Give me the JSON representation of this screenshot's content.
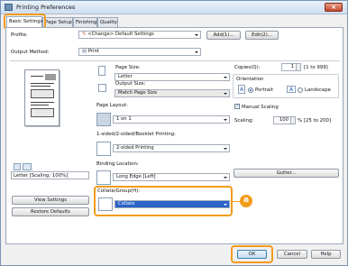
{
  "window": {
    "title": "Printing Preferences",
    "close_label": "×"
  },
  "tabs": [
    {
      "label": "Basic Settings"
    },
    {
      "label": "Page Setup"
    },
    {
      "label": "Finishing"
    },
    {
      "label": "Quality"
    }
  ],
  "profile": {
    "label": "Profile:",
    "value": "<Change> Default Settings",
    "add_label": "Add(1)...",
    "edit_label": "Edit(2)..."
  },
  "output_method": {
    "label": "Output Method:",
    "value": "Print"
  },
  "left": {
    "scaling_text": "Letter [Scaling: 100%]",
    "view_settings_label": "View Settings",
    "restore_defaults_label": "Restore Defaults"
  },
  "page_size": {
    "label": "Page Size:",
    "value": "Letter"
  },
  "output_size": {
    "label": "Output Size:",
    "value": "Match Page Size"
  },
  "page_layout": {
    "label": "Page Layout:",
    "value": "1 on 1"
  },
  "booklet": {
    "label": "1-sided/2-sided/Booklet Printing:",
    "value": "2-sided Printing"
  },
  "binding": {
    "label": "Binding Location:",
    "value": "Long Edge [Left]",
    "gutter_label": "Gutter..."
  },
  "collate": {
    "label": "Collate/Group(H):",
    "value": "Collate"
  },
  "copies": {
    "label": "Copies(Q):",
    "value": "1",
    "range": "[1 to 999]"
  },
  "orientation": {
    "label": "Orientation",
    "portrait": "Portrait",
    "landscape": "Landscape"
  },
  "manual_scaling": {
    "label": "Manual Scaling",
    "checked": true
  },
  "scaling": {
    "label": "Scaling:",
    "value": "100",
    "range": "% [25 to 200]"
  },
  "callout": {
    "letter": "a"
  },
  "footer": {
    "ok_label": "OK",
    "cancel_label": "Cancel",
    "help_label": "Help"
  },
  "colors": {
    "highlight": "#f39b1c",
    "accent": "#1f58b8"
  }
}
